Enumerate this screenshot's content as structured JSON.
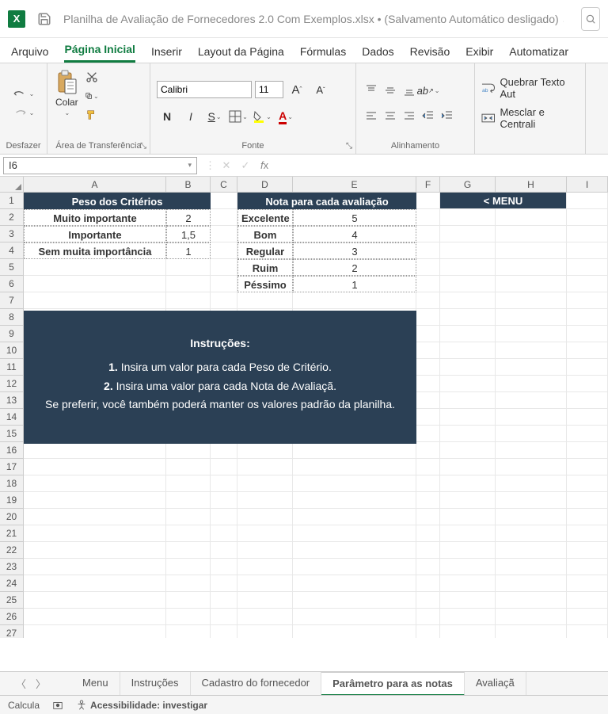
{
  "titlebar": {
    "document": "Planilha de Avaliação de Fornecedores 2.0 Com Exemplos.xlsx",
    "autosave": "(Salvamento Automático desligado)"
  },
  "menu": {
    "arquivo": "Arquivo",
    "pagina_inicial": "Página Inicial",
    "inserir": "Inserir",
    "layout": "Layout da Página",
    "formulas": "Fórmulas",
    "dados": "Dados",
    "revisao": "Revisão",
    "exibir": "Exibir",
    "automatizar": "Automatizar"
  },
  "ribbon": {
    "desfazer": "Desfazer",
    "colar": "Colar",
    "clipboard": "Área de Transferência",
    "fonte_label": "Fonte",
    "font_name": "Calibri",
    "font_size": "11",
    "alinhamento": "Alinhamento",
    "quebrar": "Quebrar Texto Aut",
    "mesclar": "Mesclar e Centrali"
  },
  "namebox": "I6",
  "columns": [
    "A",
    "B",
    "C",
    "D",
    "E",
    "F",
    "G",
    "H",
    "I"
  ],
  "rownums": [
    "1",
    "2",
    "3",
    "4",
    "5",
    "6",
    "7",
    "8",
    "9",
    "10",
    "11",
    "12",
    "13",
    "14",
    "15",
    "16",
    "17",
    "18",
    "19",
    "20",
    "21",
    "22",
    "23",
    "24",
    "25",
    "26",
    "27"
  ],
  "tables": {
    "peso_header": "Peso dos Critérios",
    "peso_rows": [
      {
        "label": "Muito importante",
        "val": "2"
      },
      {
        "label": "Importante",
        "val": "1,5"
      },
      {
        "label": "Sem muita importância",
        "val": "1"
      }
    ],
    "nota_header": "Nota para cada avaliação",
    "nota_rows": [
      {
        "label": "Excelente",
        "val": "5"
      },
      {
        "label": "Bom",
        "val": "4"
      },
      {
        "label": "Regular",
        "val": "3"
      },
      {
        "label": "Ruim",
        "val": "2"
      },
      {
        "label": "Péssimo",
        "val": "1"
      }
    ],
    "menu_btn": "< MENU"
  },
  "instructions": {
    "title": "Instruções:",
    "l1a": "1.",
    "l1b": " Insira um valor para cada Peso de Critério.",
    "l2a": "2.",
    "l2b": " Insira uma valor para cada Nota de Avaliaçã.",
    "l3": "Se preferir, você também poderá manter os valores padrão da planilha."
  },
  "sheets": {
    "menu": "Menu",
    "instrucoes": "Instruções",
    "cadastro": "Cadastro do fornecedor",
    "parametro": "Parâmetro para as notas",
    "avaliacao": "Avaliaçã"
  },
  "status": {
    "calcula": "Calcula",
    "acessibilidade": "Acessibilidade: investigar"
  }
}
